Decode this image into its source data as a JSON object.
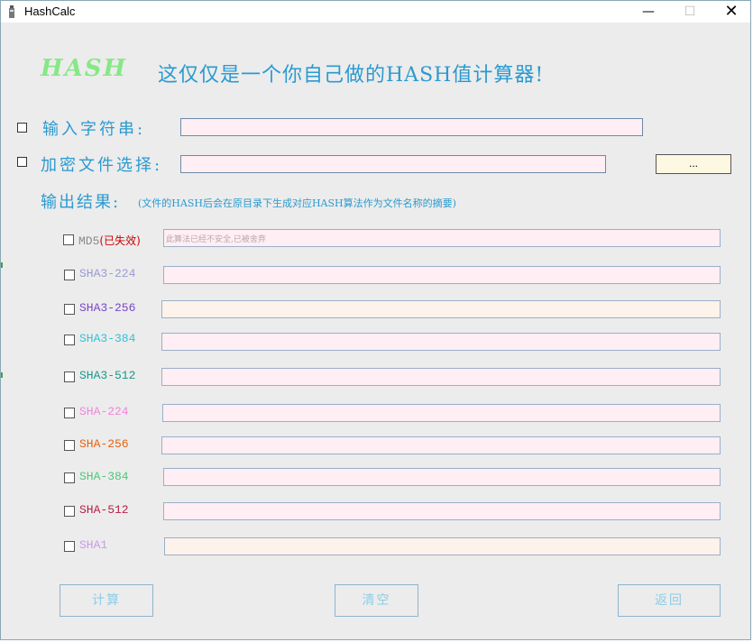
{
  "window": {
    "title": "HashCalc",
    "minimize": "—",
    "maximize": "☐",
    "close": "✕"
  },
  "header": {
    "logo": "HASH",
    "tagline": "这仅仅是一个你自己做的HASH值计算器!"
  },
  "inputs": {
    "string_label": "输入字符串:",
    "string_value": "",
    "file_label": "加密文件选择:",
    "file_value": "",
    "browse_label": "..."
  },
  "output": {
    "heading": "输出结果:",
    "note": "(文件的HASH后会在原目录下生成对应HASH算法作为文件名称的摘要)",
    "rows": [
      {
        "label": "MD5",
        "extra": "(已失效)",
        "value": "此算法已经不安全,已被舍弃",
        "color": "#8a8a8a"
      },
      {
        "label": "SHA3-224",
        "value": "",
        "color": "#9a9ad6"
      },
      {
        "label": "SHA3-256",
        "value": "",
        "color": "#7a46c8"
      },
      {
        "label": "SHA3-384",
        "value": "",
        "color": "#2ec4d8"
      },
      {
        "label": "SHA3-512",
        "value": "",
        "color": "#17998c"
      },
      {
        "label": "SHA-224",
        "value": "",
        "color": "#ef86d8"
      },
      {
        "label": "SHA-256",
        "value": "",
        "color": "#e3620e"
      },
      {
        "label": "SHA-384",
        "value": "",
        "color": "#4cc87a"
      },
      {
        "label": "SHA-512",
        "value": "",
        "color": "#b81f48"
      },
      {
        "label": "SHA1",
        "value": "",
        "color": "#c99be8"
      }
    ]
  },
  "buttons": {
    "calculate": "计算",
    "clear": "清空",
    "back": "返回"
  }
}
